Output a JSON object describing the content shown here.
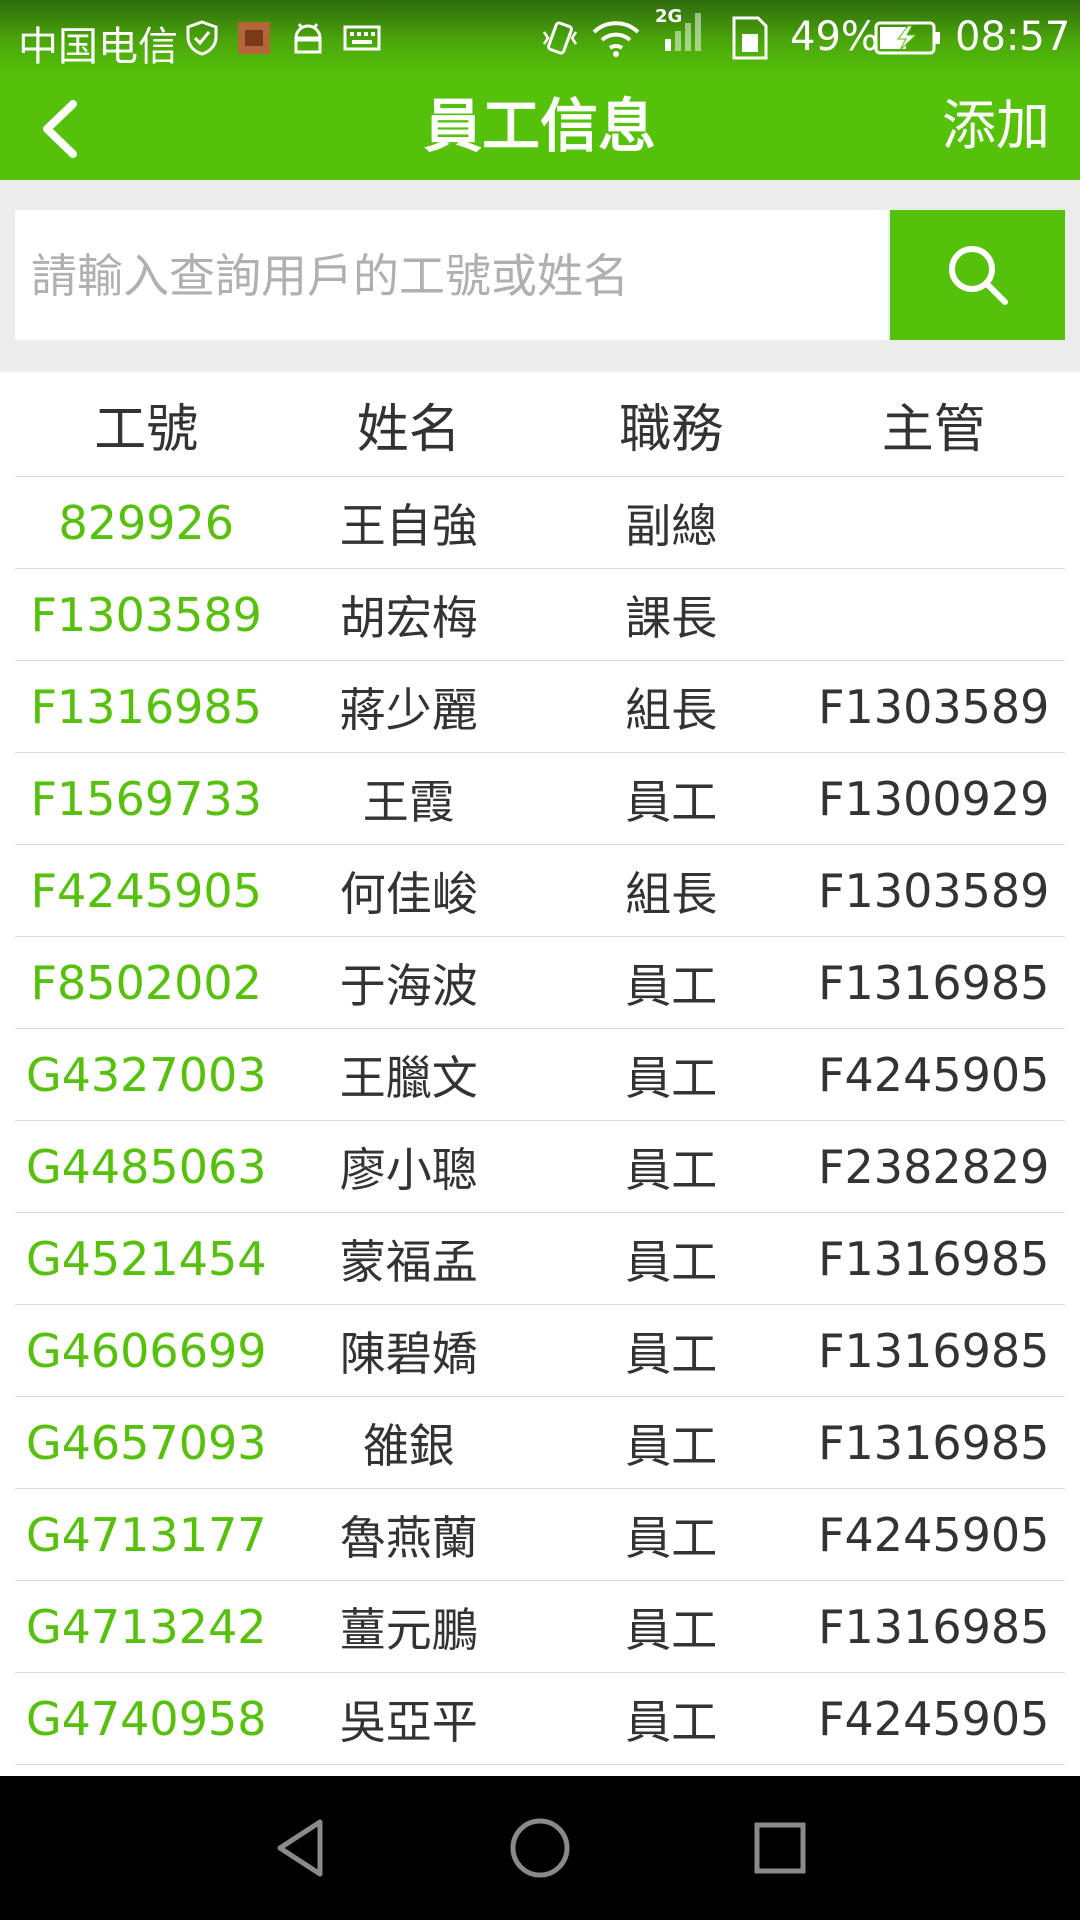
{
  "status_bar": {
    "carrier": "中国电信",
    "network": "2G",
    "battery": "49%",
    "time": "08:57"
  },
  "header": {
    "title": "員工信息",
    "add_label": "添加"
  },
  "search": {
    "placeholder": "請輸入查詢用戶的工號或姓名",
    "value": ""
  },
  "table": {
    "columns": [
      "工號",
      "姓名",
      "職務",
      "主管"
    ],
    "rows": [
      {
        "id": "829926",
        "name": "王自強",
        "role": "副總",
        "manager": ""
      },
      {
        "id": "F1303589",
        "name": "胡宏梅",
        "role": "課長",
        "manager": ""
      },
      {
        "id": "F1316985",
        "name": "蔣少麗",
        "role": "組長",
        "manager": "F1303589"
      },
      {
        "id": "F1569733",
        "name": "王霞",
        "role": "員工",
        "manager": "F1300929"
      },
      {
        "id": "F4245905",
        "name": "何佳峻",
        "role": "組長",
        "manager": "F1303589"
      },
      {
        "id": "F8502002",
        "name": "于海波",
        "role": "員工",
        "manager": "F1316985"
      },
      {
        "id": "G4327003",
        "name": "王臘文",
        "role": "員工",
        "manager": "F4245905"
      },
      {
        "id": "G4485063",
        "name": "廖小聰",
        "role": "員工",
        "manager": "F2382829"
      },
      {
        "id": "G4521454",
        "name": "蒙福孟",
        "role": "員工",
        "manager": "F1316985"
      },
      {
        "id": "G4606699",
        "name": "陳碧嬌",
        "role": "員工",
        "manager": "F1316985"
      },
      {
        "id": "G4657093",
        "name": "雒銀",
        "role": "員工",
        "manager": "F1316985"
      },
      {
        "id": "G4713177",
        "name": "魯燕蘭",
        "role": "員工",
        "manager": "F4245905"
      },
      {
        "id": "G4713242",
        "name": "薑元鵬",
        "role": "員工",
        "manager": "F1316985"
      },
      {
        "id": "G4740958",
        "name": "吳亞平",
        "role": "員工",
        "manager": "F4245905"
      }
    ]
  },
  "icons": {
    "back": "chevron-left-icon",
    "search": "search-icon",
    "nav_back": "triangle-back-icon",
    "nav_home": "circle-home-icon",
    "nav_recent": "square-recent-icon"
  },
  "colors": {
    "accent": "#55c10a",
    "id_text": "#55c10a",
    "header_text": "#ffffff",
    "search_bg": "#ececec",
    "navbar": "#000000"
  }
}
